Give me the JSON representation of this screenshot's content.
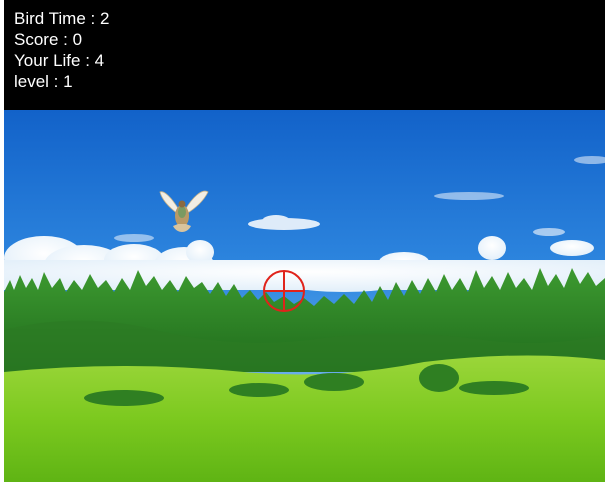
{
  "hud": {
    "bird_time": "Bird Time : 2",
    "score": "Score : 0",
    "lives": "Your Life : 4",
    "level": "level : 1"
  },
  "scene": {
    "sky_top_color": "#1b6fd6",
    "sky_bottom_color": "#8ec9f2",
    "forest_color": "#2f8a2a",
    "meadow_color": "#7ed321",
    "crosshair_color": "#e0231b",
    "bird_icon": "flying-bird-icon",
    "crosshair_icon": "crosshair-icon"
  }
}
